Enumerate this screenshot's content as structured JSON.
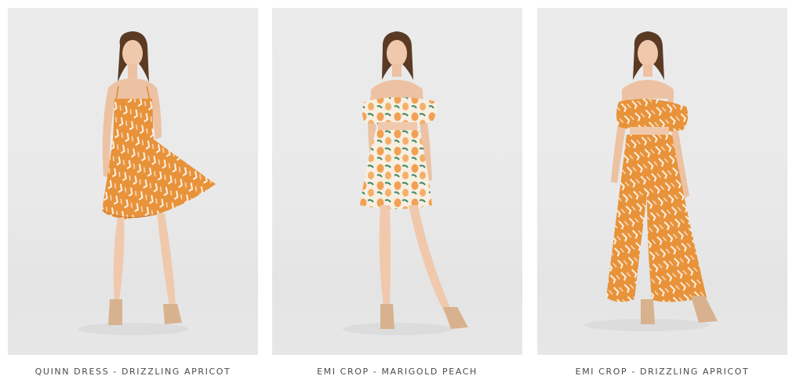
{
  "products": [
    {
      "name": "QUINN DRESS - DRIZZLING APRICOT",
      "image_icon": "model-wearing-tiered-sundress",
      "print_color": "#e8923a"
    },
    {
      "name": "EMI CROP - MARIGOLD PEACH",
      "image_icon": "model-wearing-ruffle-crop-and-skirt",
      "print_color": "#f1a05a"
    },
    {
      "name": "EMI CROP - DRIZZLING APRICOT",
      "image_icon": "model-wearing-ruffle-crop-and-wide-pants",
      "print_color": "#e8923a"
    }
  ]
}
